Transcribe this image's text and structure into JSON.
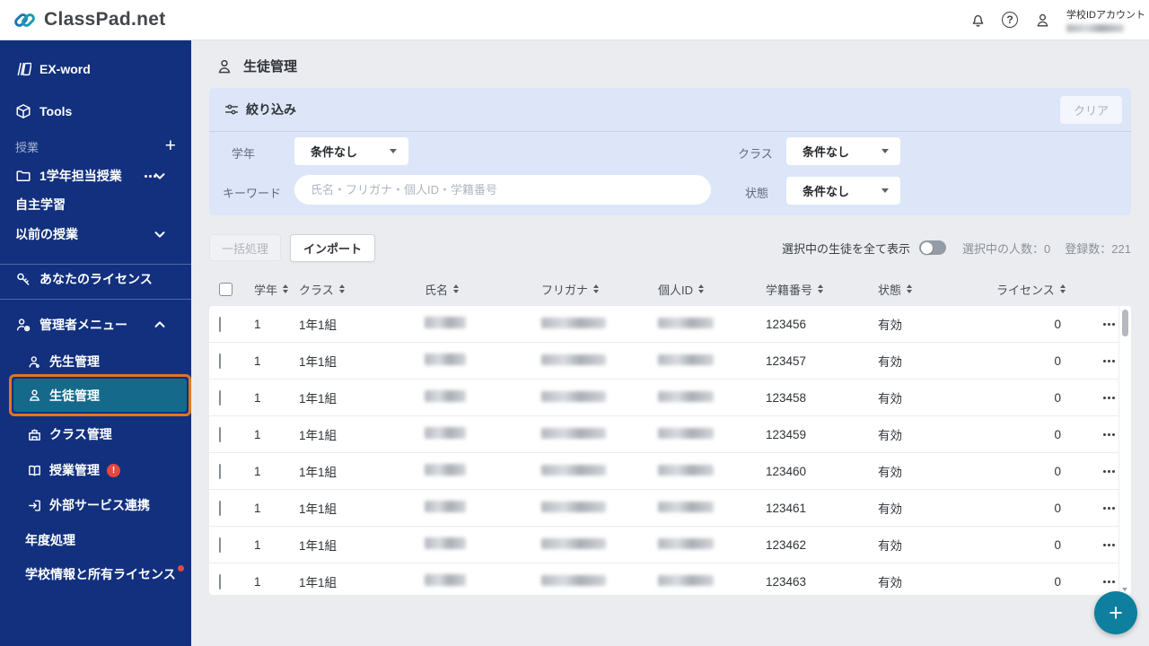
{
  "colors": {
    "sidebar_blue": "#12307e",
    "active_item_teal": "#156a8c",
    "active_outline_orange": "#e2761f",
    "accent_teal_fab": "#0e7f9e",
    "filter_panel_blue": "#dce6f8",
    "alert_red": "#e8473d",
    "logo_teal": "#1a9ab5",
    "logo_blue": "#1f75b3"
  },
  "header": {
    "logo_text": "ClassPad.net",
    "account_label": "学校IDアカウント",
    "icons": [
      "bell-icon",
      "help-icon",
      "account-icon"
    ]
  },
  "sidebar": {
    "exword": "EX-word",
    "tools": "Tools",
    "lessons_section_label": "授業",
    "lesson_folder": "1学年担当授業",
    "self_study": "自主学習",
    "previous_lessons": "以前の授業",
    "your_license": "あなたのライセンス",
    "admin_menu": "管理者メニュー",
    "teacher_mgmt": "先生管理",
    "student_mgmt": "生徒管理",
    "class_mgmt": "クラス管理",
    "lesson_mgmt": "授業管理",
    "external_services": "外部サービス連携",
    "year_processing": "年度処理",
    "school_info": "学校情報と所有ライセンス"
  },
  "main": {
    "page_title": "生徒管理",
    "filter": {
      "title": "絞り込み",
      "clear": "クリア",
      "grade_label": "学年",
      "grade_value": "条件なし",
      "class_label": "クラス",
      "class_value": "条件なし",
      "keyword_label": "キーワード",
      "keyword_placeholder": "氏名・フリガナ・個人ID・学籍番号",
      "status_label": "状態",
      "status_value": "条件なし"
    },
    "toolbar": {
      "bulk": "一括処理",
      "import": "インポート",
      "show_selected": "選択中の生徒を全て表示",
      "selected_label": "選択中の人数：",
      "selected_value": "0",
      "registered_label": "登録数：",
      "registered_value": "221"
    },
    "table": {
      "columns": [
        "学年",
        "クラス",
        "氏名",
        "フリガナ",
        "個人ID",
        "学籍番号",
        "状態",
        "ライセンス"
      ],
      "rows": [
        {
          "grade": "1",
          "class_name": "1年1組",
          "student_no": "123456",
          "status": "有効",
          "license": "0"
        },
        {
          "grade": "1",
          "class_name": "1年1組",
          "student_no": "123457",
          "status": "有効",
          "license": "0"
        },
        {
          "grade": "1",
          "class_name": "1年1組",
          "student_no": "123458",
          "status": "有効",
          "license": "0"
        },
        {
          "grade": "1",
          "class_name": "1年1組",
          "student_no": "123459",
          "status": "有効",
          "license": "0"
        },
        {
          "grade": "1",
          "class_name": "1年1組",
          "student_no": "123460",
          "status": "有効",
          "license": "0"
        },
        {
          "grade": "1",
          "class_name": "1年1組",
          "student_no": "123461",
          "status": "有効",
          "license": "0"
        },
        {
          "grade": "1",
          "class_name": "1年1組",
          "student_no": "123462",
          "status": "有効",
          "license": "0"
        },
        {
          "grade": "1",
          "class_name": "1年1組",
          "student_no": "123463",
          "status": "有効",
          "license": "0"
        }
      ]
    }
  }
}
